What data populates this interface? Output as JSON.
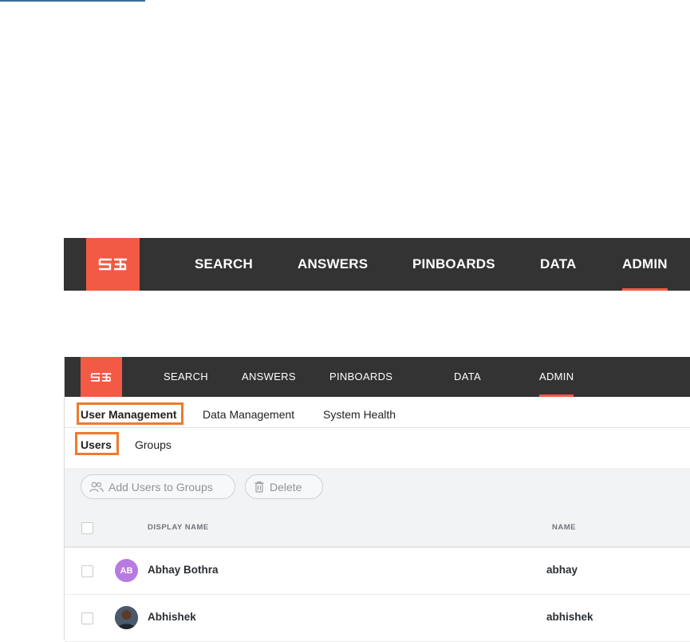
{
  "brand": {
    "accent": "#f25a45",
    "nav_bg": "#333333",
    "highlight_box": "#f07a2c",
    "avatar_ab": "#b77ae0"
  },
  "nav_large": {
    "logo": "thoughtspot-logo",
    "items": [
      "SEARCH",
      "ANSWERS",
      "PINBOARDS",
      "DATA",
      "ADMIN"
    ],
    "active": "ADMIN"
  },
  "nav_small": {
    "logo": "thoughtspot-logo",
    "items": [
      "SEARCH",
      "ANSWERS",
      "PINBOARDS",
      "DATA",
      "ADMIN"
    ],
    "active": "ADMIN"
  },
  "admin_tabs": [
    "User Management",
    "Data Management",
    "System Health"
  ],
  "user_tabs": [
    "Users",
    "Groups"
  ],
  "toolbar": {
    "add_to_groups": "Add Users to Groups",
    "delete": "Delete"
  },
  "table": {
    "columns": [
      "DISPLAY NAME",
      "NAME"
    ],
    "rows": [
      {
        "initials": "AB",
        "display_name": "Abhay Bothra",
        "name": "abhay"
      },
      {
        "initials": "",
        "display_name": "Abhishek",
        "name": "abhishek"
      }
    ]
  }
}
